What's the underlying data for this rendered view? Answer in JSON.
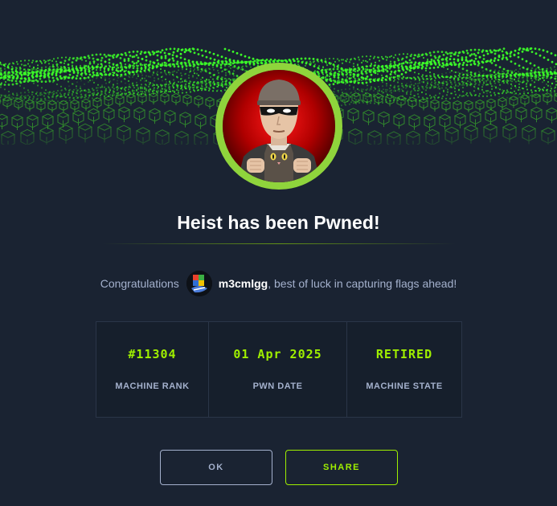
{
  "colors": {
    "background": "#1a2332",
    "accent": "#9fef00",
    "text_muted": "#a4b1cd",
    "text_primary": "#ffffff",
    "ring": "#8fd43c"
  },
  "banner": {
    "icon": "green-cube-grid-banner"
  },
  "machine": {
    "avatar_icon": "thief-with-cat-avatar"
  },
  "title": "Heist has been Pwned!",
  "congrats": {
    "prefix": "Congratulations",
    "user_avatar_icon": "user-avatar",
    "username": "m3cmlgg",
    "suffix": ", best of luck in capturing flags ahead!"
  },
  "stats": [
    {
      "value": "#11304",
      "label": "MACHINE RANK"
    },
    {
      "value": "01 Apr 2025",
      "label": "PWN DATE"
    },
    {
      "value": "RETIRED",
      "label": "MACHINE STATE"
    }
  ],
  "buttons": {
    "ok": "OK",
    "share": "SHARE"
  }
}
